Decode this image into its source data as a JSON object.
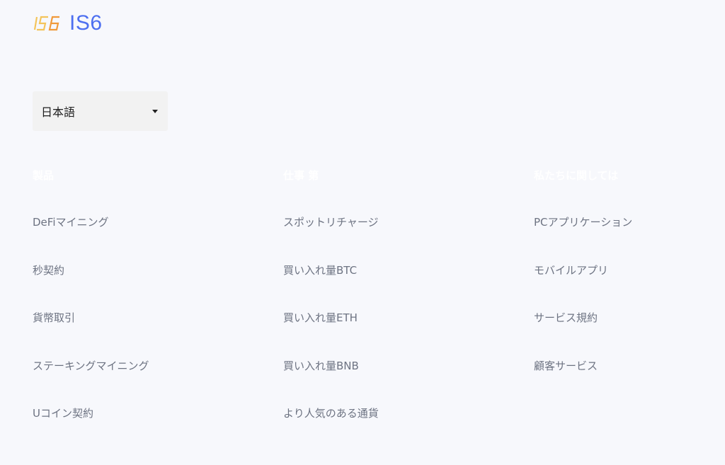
{
  "brand": {
    "name": "IS6",
    "logo_icon": "is6-logo-icon",
    "color": "#4d6ff0",
    "logo_colors": [
      "#f4c45a",
      "#f09a3a"
    ]
  },
  "language": {
    "selected": "日本語",
    "icon": "caret-down-icon"
  },
  "footer": {
    "columns": [
      {
        "heading": "製品",
        "items": [
          "DeFiマイニング",
          "秒契約",
          "貨幣取引",
          "ステーキングマイニング",
          "Uコイン契約"
        ]
      },
      {
        "heading": "仕事 第",
        "items": [
          "スポットリチャージ",
          "買い入れ量BTC",
          "買い入れ量ETH",
          "買い入れ量BNB",
          "より人気のある通貨"
        ]
      },
      {
        "heading": "私たちに関しては",
        "items": [
          "PCアプリケーション",
          "モバイルアプリ",
          "サービス規約",
          "顧客サービス"
        ]
      }
    ]
  }
}
